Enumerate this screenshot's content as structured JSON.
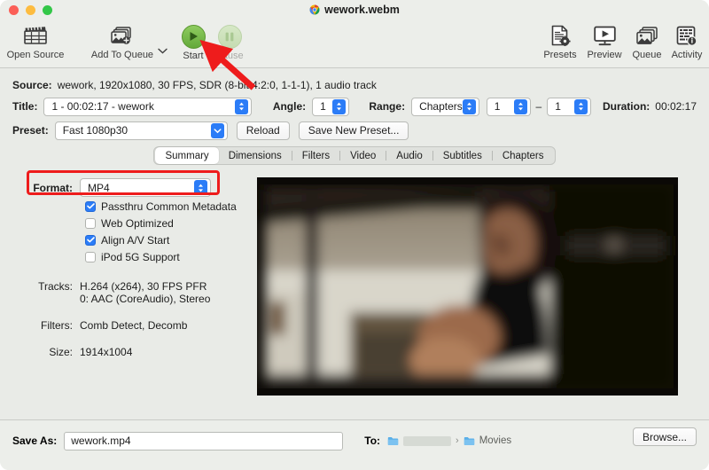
{
  "window": {
    "title": "wework.webm",
    "app_icon": "chrome-icon",
    "traffic_lights": [
      "close",
      "minimize",
      "maximize"
    ]
  },
  "toolbar": {
    "left_items": [
      {
        "label": "Open Source",
        "icon": "clapperboard-icon",
        "enabled": true
      },
      {
        "label": "Add To Queue",
        "icon": "add-to-queue-icon",
        "enabled": true
      },
      {
        "label": "Start",
        "icon": "play-icon",
        "enabled": true
      },
      {
        "label": "Pause",
        "icon": "pause-icon",
        "enabled": false
      }
    ],
    "right_items": [
      {
        "label": "Presets",
        "icon": "presets-icon"
      },
      {
        "label": "Preview",
        "icon": "preview-icon"
      },
      {
        "label": "Queue",
        "icon": "queue-icon"
      },
      {
        "label": "Activity",
        "icon": "activity-icon"
      }
    ],
    "queue_dropdown": "chevron-down-icon"
  },
  "source": {
    "label": "Source:",
    "value": "wework, 1920x1080, 30 FPS, SDR (8-bit 4:2:0, 1-1-1), 1 audio track"
  },
  "title_row": {
    "label": "Title:",
    "value": "1 - 00:02:17 - wework",
    "angle_label": "Angle:",
    "angle_value": "1"
  },
  "range": {
    "label": "Range:",
    "type_value": "Chapters",
    "start_value": "1",
    "dash": "–",
    "end_value": "1",
    "duration_label": "Duration:",
    "duration_value": "00:02:17"
  },
  "preset": {
    "label": "Preset:",
    "value": "Fast 1080p30",
    "reload_label": "Reload",
    "save_new_label": "Save New Preset..."
  },
  "tabs": [
    {
      "label": "Summary",
      "active": true
    },
    {
      "label": "Dimensions",
      "active": false
    },
    {
      "label": "Filters",
      "active": false
    },
    {
      "label": "Video",
      "active": false
    },
    {
      "label": "Audio",
      "active": false
    },
    {
      "label": "Subtitles",
      "active": false
    },
    {
      "label": "Chapters",
      "active": false
    }
  ],
  "summary": {
    "format_label": "Format:",
    "format_value": "MP4",
    "checkboxes": [
      {
        "label": "Passthru Common Metadata",
        "checked": true
      },
      {
        "label": "Web Optimized",
        "checked": false
      },
      {
        "label": "Align A/V Start",
        "checked": true
      },
      {
        "label": "iPod 5G Support",
        "checked": false
      }
    ],
    "tracks_label": "Tracks:",
    "tracks_line1": "H.264 (x264), 30 FPS PFR",
    "tracks_line2": "0: AAC (CoreAudio), Stereo",
    "filters_label": "Filters:",
    "filters_value": "Comb Detect, Decomb",
    "size_label": "Size:",
    "size_value": "1914x1004"
  },
  "bottom": {
    "save_as_label": "Save As:",
    "save_as_value": "wework.mp4",
    "to_label": "To:",
    "path_redacted": "",
    "path_separator": "›",
    "path_final": "Movies",
    "browse_label": "Browse..."
  },
  "annotations": {
    "arrow_color": "#ee1c1c",
    "highlight_color": "#ee1c1c",
    "arrow_target": "start-button",
    "highlight_target": "format-row"
  },
  "colors": {
    "toolbar_bg": "#eceeea",
    "panel_bg": "#e9ebe7",
    "accent_blue": "#2b7cf7",
    "start_green": "#63a93a",
    "annotation_red": "#ee1c1c"
  }
}
